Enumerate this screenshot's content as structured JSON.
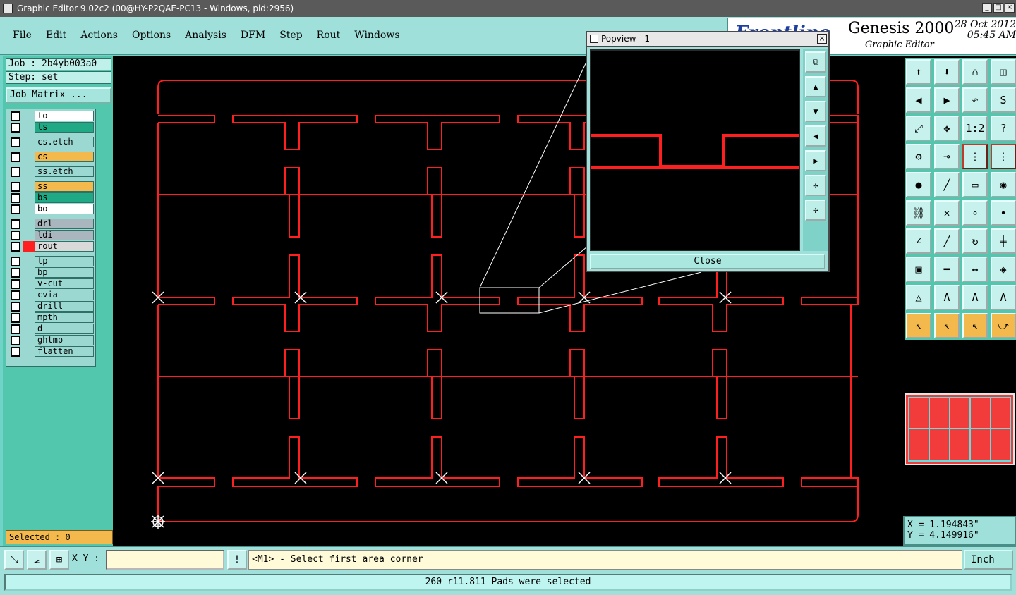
{
  "window": {
    "title": "Graphic Editor 9.02c2 (00@HY-P2QAE-PC13 - Windows, pid:2956)"
  },
  "menu": [
    "File",
    "Edit",
    "Actions",
    "Options",
    "Analysis",
    "DFM",
    "Step",
    "Rout",
    "Windows"
  ],
  "brand": {
    "logo": "Frontline",
    "title": "Genesis 2000",
    "subtitle": "Graphic Editor",
    "date": "28 Oct 2012",
    "time": "05:45 AM"
  },
  "job": {
    "job_line": "Job : 2b4yb003a0",
    "step_line": "Step: set",
    "matrix_button": "Job Matrix ..."
  },
  "layers": [
    {
      "name": "to",
      "color": "#ffffff"
    },
    {
      "name": "ts",
      "color": "#1faa85"
    },
    {
      "name": "cs.etch",
      "color": "#9ad8d1"
    },
    {
      "name": "cs",
      "color": "#f4b94d"
    },
    {
      "name": "ss.etch",
      "color": "#9ad8d1"
    },
    {
      "name": "ss",
      "color": "#f4b94d"
    },
    {
      "name": "bs",
      "color": "#1faa85"
    },
    {
      "name": "bo",
      "color": "#ffffff"
    },
    {
      "name": "drl",
      "color": "#a9b6bd"
    },
    {
      "name": "ldi",
      "color": "#a9b6bd"
    },
    {
      "name": "rout",
      "color": "#d9d9d9"
    },
    {
      "name": "tp",
      "color": "#9ad8d1"
    },
    {
      "name": "bp",
      "color": "#9ad8d1"
    },
    {
      "name": "v-cut",
      "color": "#9ad8d1"
    },
    {
      "name": "cvia",
      "color": "#9ad8d1"
    },
    {
      "name": "drill",
      "color": "#9ad8d1"
    },
    {
      "name": "mpth",
      "color": "#9ad8d1"
    },
    {
      "name": "d",
      "color": "#9ad8d1"
    },
    {
      "name": "ghtmp",
      "color": "#9ad8d1"
    },
    {
      "name": "flatten",
      "color": "#9ad8d1"
    }
  ],
  "selected": "Selected : 0",
  "popview": {
    "title": "Popview - 1",
    "close": "Close"
  },
  "coords": {
    "x": "X = 1.194843\"",
    "y": "Y = 4.149916\""
  },
  "cmd": {
    "xy_label": "X Y :",
    "xy_value": "",
    "prompt": "<M1> - Select first area corner",
    "unit": "Inch"
  },
  "status": "260 r11.811 Pads were selected",
  "colors": {
    "panel": "#9fe1da",
    "accent": "#52c7ae",
    "trace": "#ff1f1f",
    "highlight": "#f4b94d"
  }
}
